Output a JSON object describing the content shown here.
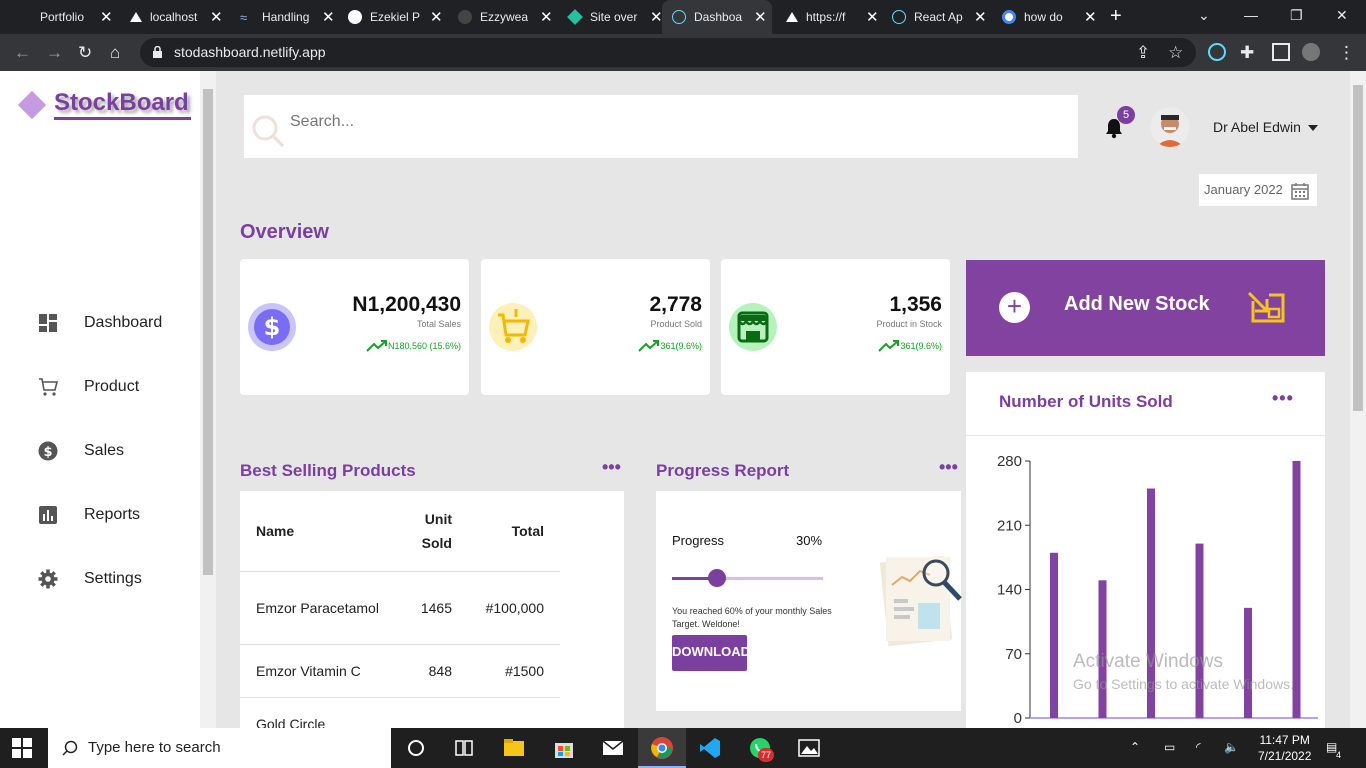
{
  "browser": {
    "tabs": [
      {
        "title": "Portfolio",
        "active": false
      },
      {
        "title": "localhost",
        "active": false
      },
      {
        "title": "Handling",
        "active": false
      },
      {
        "title": "Ezekiel P",
        "active": false
      },
      {
        "title": "Ezzywea",
        "active": false
      },
      {
        "title": "Site over",
        "active": false
      },
      {
        "title": "Dashboa",
        "active": true
      },
      {
        "title": "https://f",
        "active": false
      },
      {
        "title": "React Ap",
        "active": false
      },
      {
        "title": "how do",
        "active": false
      }
    ],
    "url": "stodashboard.netlify.app"
  },
  "sidebar": {
    "logo": "StockBoard",
    "items": [
      {
        "label": "Dashboard",
        "icon": "dashboard-icon"
      },
      {
        "label": "Product",
        "icon": "cart-icon"
      },
      {
        "label": "Sales",
        "icon": "dollar-icon"
      },
      {
        "label": "Reports",
        "icon": "bar-chart-icon"
      },
      {
        "label": "Settings",
        "icon": "gear-icon"
      }
    ]
  },
  "header": {
    "search_placeholder": "Search...",
    "notification_count": "5",
    "user_name": "Dr Abel Edwin",
    "date": "January 2022"
  },
  "overview": {
    "title": "Overview",
    "cards": [
      {
        "value": "N1,200,430",
        "label": "Total Sales",
        "change": "N180,560 (15.6%)",
        "color": "#7b6cf5"
      },
      {
        "value": "2,778",
        "label": "Product Sold",
        "change": "361(9.6%)",
        "color": "#f5c518"
      },
      {
        "value": "1,356",
        "label": "Product in Stock",
        "change": "361(9.6%)",
        "color": "#1aa82a"
      }
    ]
  },
  "add_stock": {
    "label": "Add New Stock"
  },
  "units_chart": {
    "title": "Number of Units Sold",
    "menu": "•••"
  },
  "best_selling": {
    "title": "Best Selling Products",
    "menu": "•••",
    "headers": {
      "name": "Name",
      "unit_sold_1": "Unit",
      "unit_sold_2": "Sold",
      "total": "Total"
    },
    "rows": [
      {
        "name": "Emzor Paracetamol",
        "units": "1465",
        "total": "#100,000"
      },
      {
        "name": "Emzor Vitamin C",
        "units": "848",
        "total": "#1500"
      },
      {
        "name": "Gold Circle",
        "units": "",
        "total": ""
      }
    ]
  },
  "progress": {
    "title": "Progress Report",
    "menu": "•••",
    "label": "Progress",
    "value_text": "30%",
    "value": 0.3,
    "message": "You reached 60% of your monthly Sales Target. Weldone!",
    "button": "DOWNLOAD"
  },
  "chart_data": {
    "type": "bar",
    "title": "Number of Units Sold",
    "categories": [
      "",
      "",
      "",
      "",
      "",
      ""
    ],
    "values": [
      180,
      150,
      250,
      190,
      120,
      280
    ],
    "ylim": [
      0,
      280
    ],
    "yticks": [
      "280",
      "210",
      "140",
      "70",
      "0"
    ],
    "color": "#8142a0"
  },
  "watermark": {
    "line1": "Activate Windows",
    "line2": "Go to Settings to activate Windows."
  },
  "taskbar": {
    "search_placeholder": "Type here to search",
    "time": "11:47 PM",
    "date": "7/21/2022",
    "whatsapp_badge": "77",
    "notif_count": "4"
  }
}
